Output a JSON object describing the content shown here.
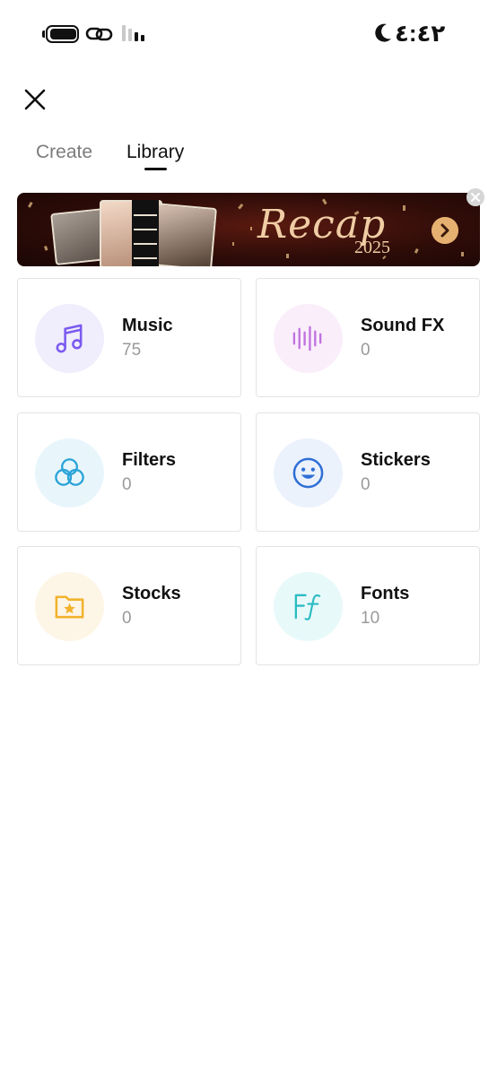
{
  "status_bar": {
    "time": "٤:٤٢",
    "icons": [
      "battery-icon",
      "link-icon",
      "signal-icon",
      "moon-icon"
    ]
  },
  "header": {
    "close_icon": "close-icon"
  },
  "tabs": [
    {
      "label": "Create",
      "active": false
    },
    {
      "label": "Library",
      "active": true
    }
  ],
  "banner": {
    "title": "Recap",
    "year": "2025",
    "arrow_icon": "chevron-right-icon",
    "dismiss_icon": "close-icon"
  },
  "cards": [
    {
      "title": "Music",
      "count": "75",
      "icon": "music-note-icon",
      "accent": "#7a5af0",
      "bg": "#f0edfc"
    },
    {
      "title": "Sound FX",
      "count": "0",
      "icon": "sound-wave-icon",
      "accent": "#c172e0",
      "bg": "#faeefb"
    },
    {
      "title": "Filters",
      "count": "0",
      "icon": "filters-circles-icon",
      "accent": "#2aa3d8",
      "bg": "#e8f6fc"
    },
    {
      "title": "Stickers",
      "count": "0",
      "icon": "smiley-icon",
      "accent": "#2f6fd6",
      "bg": "#ebf2fc"
    },
    {
      "title": "Stocks",
      "count": "0",
      "icon": "star-folder-icon",
      "accent": "#f2b22c",
      "bg": "#fdf5e6"
    },
    {
      "title": "Fonts",
      "count": "10",
      "icon": "font-ff-icon",
      "accent": "#2bbcc3",
      "bg": "#e8f9fa"
    }
  ]
}
